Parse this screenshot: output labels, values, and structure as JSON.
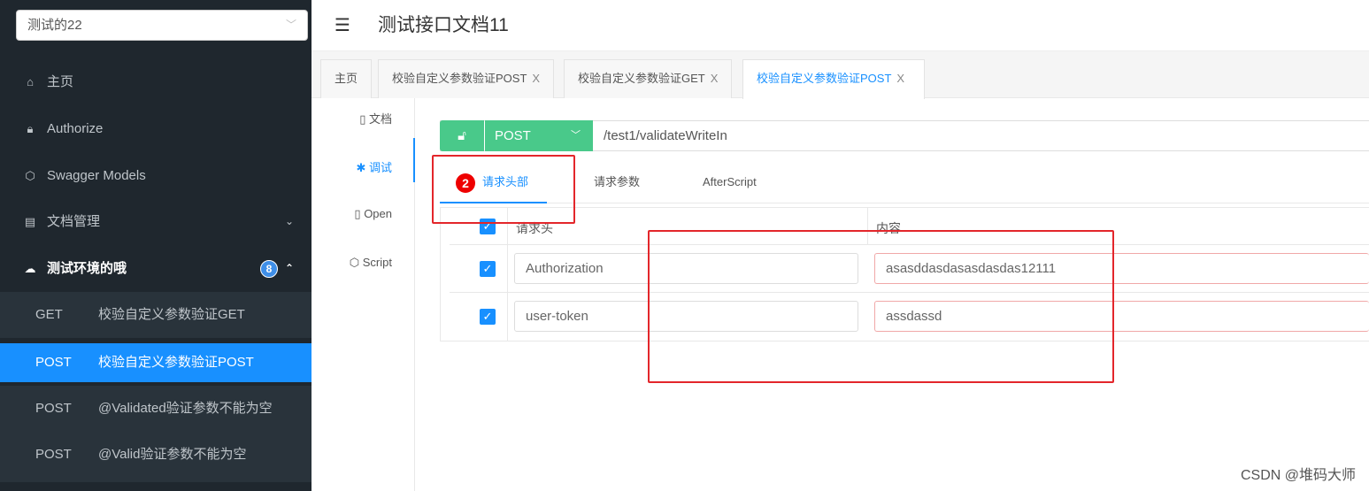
{
  "sidebar": {
    "project": "测试的22",
    "items": [
      {
        "label": "主页",
        "icon": "home-icon"
      },
      {
        "label": "Authorize",
        "icon": "lock-icon"
      },
      {
        "label": "Swagger Models",
        "icon": "cube-icon"
      },
      {
        "label": "文档管理",
        "icon": "doc-settings-icon"
      },
      {
        "label": "测试环境的哦",
        "icon": "cloud-icon",
        "badge": "8"
      }
    ],
    "subitems": [
      {
        "method": "GET",
        "label": "校验自定义参数验证GET"
      },
      {
        "method": "POST",
        "label": "校验自定义参数验证POST",
        "active": true
      },
      {
        "method": "POST",
        "label": "@Validated验证参数不能为空"
      },
      {
        "method": "POST",
        "label": "@Valid验证参数不能为空"
      }
    ]
  },
  "header": {
    "title": "测试接口文档11"
  },
  "tabs": [
    {
      "label": "主页"
    },
    {
      "label": "校验自定义参数验证POST",
      "close": "X"
    },
    {
      "label": "校验自定义参数验证GET",
      "close": "X"
    },
    {
      "label": "校验自定义参数验证POST",
      "close": "X",
      "active": true
    }
  ],
  "inner_nav": [
    {
      "label": "文档"
    },
    {
      "label": "调试",
      "active": true
    },
    {
      "label": "Open"
    },
    {
      "label": "Script"
    }
  ],
  "request": {
    "method": "POST",
    "path": "/test1/validateWriteIn"
  },
  "subtabs": [
    {
      "label": "请求头部",
      "badge": "2",
      "active": true
    },
    {
      "label": "请求参数"
    },
    {
      "label": "AfterScript"
    }
  ],
  "headers_table": {
    "columns": [
      "请求头",
      "内容"
    ],
    "rows": [
      {
        "checked": true,
        "name": "Authorization",
        "value": "asasddasdasasdasdas12111"
      },
      {
        "checked": true,
        "name": "user-token",
        "value": "assdassd"
      }
    ]
  },
  "watermark": "CSDN @堆码大师",
  "colors": {
    "accent": "#1890ff",
    "method": "#49c98a",
    "annotation": "#e3262b",
    "sidebar": "#1f272e"
  }
}
